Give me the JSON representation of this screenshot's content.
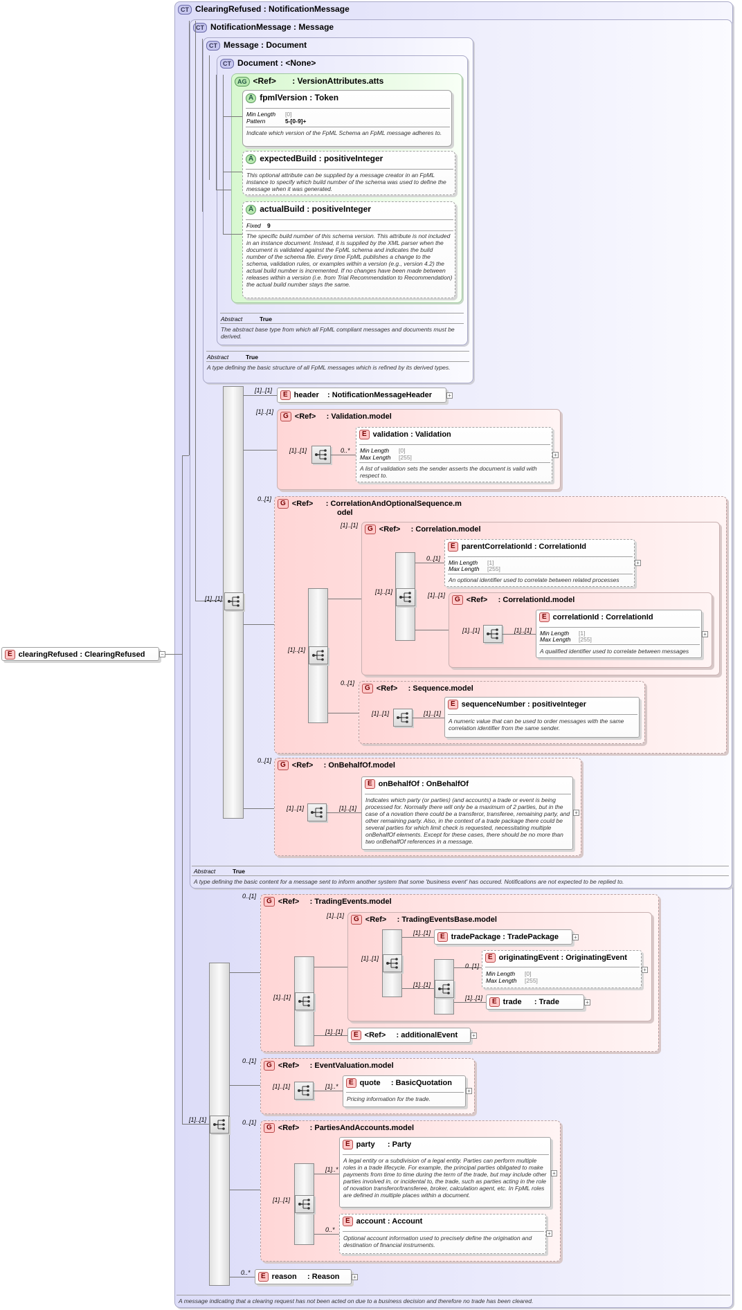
{
  "root": {
    "badge": "E",
    "name": "clearingRefused",
    "type": "ClearingRefused"
  },
  "ct_clearing": {
    "badge": "CT",
    "name": "ClearingRefused",
    "type": "NotificationMessage",
    "doc": "A message indicating that a clearing request has not been acted on due to a business decision and therefore no trade has been cleared."
  },
  "ct_notification": {
    "badge": "CT",
    "name": "NotificationMessage",
    "type": "Message",
    "abstract_label": "Abstract",
    "abstract_value": "True",
    "doc": "A type defining the basic content for a message sent to inform another system that some 'business event' has occured. Notifications are not expected to be replied to."
  },
  "ct_message": {
    "badge": "CT",
    "name": "Message",
    "type": "Document",
    "abstract_label": "Abstract",
    "abstract_value": "True",
    "doc": "A type defining the basic structure of all FpML messages which is refined by its derived types."
  },
  "ct_document": {
    "badge": "CT",
    "name": "Document",
    "type": "<None>",
    "abstract_label": "Abstract",
    "abstract_value": "True",
    "doc": "The abstract base type from which all FpML compliant messages and documents must be derived."
  },
  "ag_version": {
    "badge": "AG",
    "ref": "<Ref>",
    "type": "VersionAttributes.atts"
  },
  "attr_fpml": {
    "badge": "A",
    "name": "fpmlVersion",
    "type": "Token",
    "f1_label": "Min Length",
    "f1_value": "[0]",
    "f2_label": "Pattern",
    "f2_value": "5-[0-9]+",
    "doc": "Indicate which version of the FpML Schema an FpML message adheres to."
  },
  "attr_expected": {
    "badge": "A",
    "name": "expectedBuild",
    "type": "positiveInteger",
    "doc": "This optional attribute can be supplied by a message creator in an FpML instance to specify which build number of the schema was used to define the message when it was generated."
  },
  "attr_actual": {
    "badge": "A",
    "name": "actualBuild",
    "type": "positiveInteger",
    "f1_label": "Fixed",
    "f1_value": "9",
    "doc": "The specific build number of this schema version. This attribute is not included in an instance document. Instead, it is supplied by the XML parser when the document is validated against the FpML schema and indicates the build number of the schema file. Every time FpML publishes a change to the schema, validation rules, or examples within a version (e.g., version 4.2) the actual build number is incremented. If no changes have been made between releases within a version (i.e. from Trial Recommendation to Recommendation) the actual build number stays the same."
  },
  "el_header": {
    "badge": "E",
    "name": "header",
    "type": "NotificationMessageHeader",
    "card": "[1]..[1]"
  },
  "grp_validation": {
    "badge": "G",
    "ref": "<Ref>",
    "type": "Validation.model",
    "card": "[1]..[1]",
    "seq_card": "[1]..[1]"
  },
  "el_validation": {
    "badge": "E",
    "name": "validation",
    "type": "Validation",
    "card": "0..*",
    "f1_label": "Min Length",
    "f1_value": "[0]",
    "f2_label": "Max Length",
    "f2_value": "[255]",
    "doc": "A list of validation sets the sender asserts the document is valid with respect to."
  },
  "grp_corr_opt": {
    "badge": "G",
    "ref": "<Ref>",
    "type": "CorrelationAndOptionalSequence.m",
    "type2": "odel",
    "card": "0..[1]",
    "seq_card": "[1]..[1]"
  },
  "grp_corr": {
    "badge": "G",
    "ref": "<Ref>",
    "type": "Correlation.model",
    "card": "[1]..[1]",
    "seq_card": "[1]..[1]"
  },
  "el_parent": {
    "badge": "E",
    "name": "parentCorrelationId",
    "type": "CorrelationId",
    "card": "0..[1]",
    "f1_label": "Min Length",
    "f1_value": "[1]",
    "f2_label": "Max Length",
    "f2_value": "[255]",
    "doc": "An optional identifier used to correlate between related processes"
  },
  "grp_corrid": {
    "badge": "G",
    "ref": "<Ref>",
    "type": "CorrelationId.model",
    "card": "[1]..[1]",
    "seq_card": "[1]..[1]"
  },
  "el_corrid": {
    "badge": "E",
    "name": "correlationId",
    "type": "CorrelationId",
    "card": "[1]..[1]",
    "f1_label": "Min Length",
    "f1_value": "[1]",
    "f2_label": "Max Length",
    "f2_value": "[255]",
    "doc": "A qualified identifier used to correlate between messages"
  },
  "grp_seq": {
    "badge": "G",
    "ref": "<Ref>",
    "type": "Sequence.model",
    "card": "0..[1]",
    "seq_card": "[1]..[1]"
  },
  "el_seqnum": {
    "badge": "E",
    "name": "sequenceNumber",
    "type": "positiveInteger",
    "card": "[1]..[1]",
    "doc": "A numeric value that can be used to order messages with the same correlation identifier from the same sender."
  },
  "grp_behalf": {
    "badge": "G",
    "ref": "<Ref>",
    "type": "OnBehalfOf.model",
    "card": "0..[1]",
    "seq_card": "[1]..[1]"
  },
  "el_behalf": {
    "badge": "E",
    "name": "onBehalfOf",
    "type": "OnBehalfOf",
    "card": "[1]..[1]",
    "doc": "Indicates which party (or parties) (and accounts) a trade or event is being processed for. Normally there will only be a maximum of 2 parties, but in the case of a novation there could be a transferor, transferee, remaining party, and other remaining party. Also, in the context of a trade package there could be several parties for which limit check is requested, necessitating multiple onBehalfOf elements. Except for these cases, there should be no more than two onBehalfOf references in a message."
  },
  "seq_main_card": "[1]..[1]",
  "seq_second_card": "[1]..[1]",
  "grp_trading": {
    "badge": "G",
    "ref": "<Ref>",
    "type": "TradingEvents.model",
    "card": "0..[1]",
    "seq_card": "[1]..[1]"
  },
  "grp_tradingbase": {
    "badge": "G",
    "ref": "<Ref>",
    "type": "TradingEventsBase.model",
    "card": "[1]..[1]",
    "choice_card": "[1]..[1]"
  },
  "el_tradepkg": {
    "badge": "E",
    "name": "tradePackage",
    "type": "TradePackage",
    "card": "[1]..[1]"
  },
  "seq_inner_card": "[1]..[1]",
  "el_origevent": {
    "badge": "E",
    "name": "originatingEvent",
    "type": "OriginatingEvent",
    "card": "0..[1]",
    "f1_label": "Min Length",
    "f1_value": "[0]",
    "f2_label": "Max Length",
    "f2_value": "[255]"
  },
  "el_trade": {
    "badge": "E",
    "name": "trade",
    "type": "Trade",
    "card": "[1]..[1]"
  },
  "el_addevent": {
    "badge": "E",
    "ref": "<Ref>",
    "type": "additionalEvent",
    "card": "[1]..[1]"
  },
  "grp_valuation": {
    "badge": "G",
    "ref": "<Ref>",
    "type": "EventValuation.model",
    "card": "0..[1]",
    "seq_card": "[1]..[1]"
  },
  "el_quote": {
    "badge": "E",
    "name": "quote",
    "type": "BasicQuotation",
    "card": "[1]..*",
    "doc": "Pricing information for the trade."
  },
  "grp_parties": {
    "badge": "G",
    "ref": "<Ref>",
    "type": "PartiesAndAccounts.model",
    "card": "0..[1]",
    "seq_card": "[1]..[1]"
  },
  "el_party": {
    "badge": "E",
    "name": "party",
    "type": "Party",
    "card": "[1]..*",
    "doc": "A legal entity or a subdivision of a legal entity. Parties can perform multiple roles in a trade lifecycle. For example, the principal parties obligated to make payments from time to time during the term of the trade, but may include other parties involved in, or incidental to, the trade, such as parties acting in the role of novation transferor/transferee, broker, calculation agent, etc. In FpML roles are defined in multiple places within a document."
  },
  "el_account": {
    "badge": "E",
    "name": "account",
    "type": "Account",
    "card": "0..*",
    "doc": "Optional account information used to precisely define the origination and destination of financial instruments."
  },
  "el_reason": {
    "badge": "E",
    "name": "reason",
    "type": "Reason",
    "card": "0..*"
  },
  "separator": ":"
}
